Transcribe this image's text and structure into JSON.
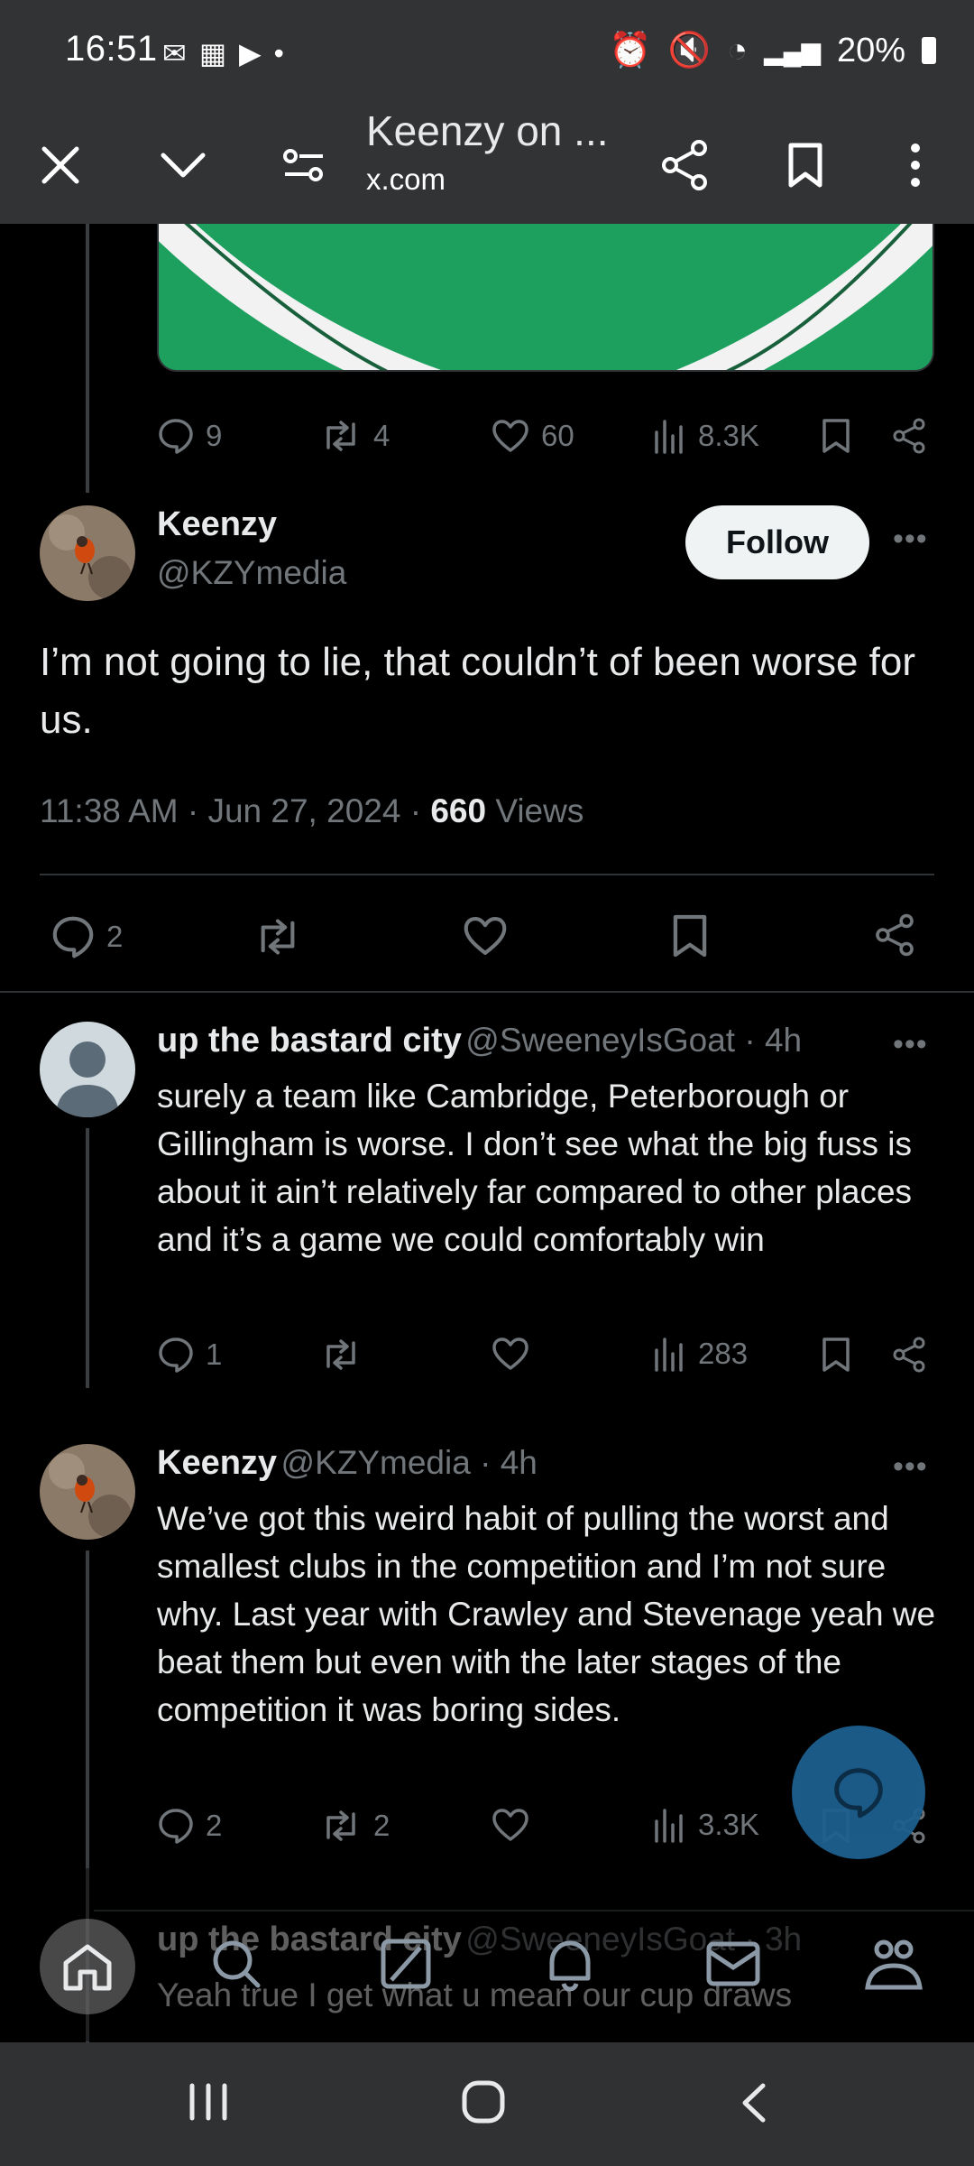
{
  "status": {
    "time": "16:51",
    "battery": "20%"
  },
  "toolbar": {
    "title": "Keenzy on ...",
    "url": "x.com"
  },
  "prev_post_actions": {
    "replies": "9",
    "reposts": "4",
    "likes": "60",
    "views": "8.3K"
  },
  "main_post": {
    "name": "Keenzy",
    "handle": "@KZYmedia",
    "follow_label": "Follow",
    "text": "I’m not going to lie, that couldn’t of been worse for us.",
    "timestamp": "11:38 AM · Jun 27, 2024 · ",
    "views_count": "660",
    "views_label": " Views",
    "replies": "2"
  },
  "replies": [
    {
      "name": "up the bastard city",
      "handle": "@SweeneyIsGoat",
      "time": " · 4h",
      "text": "surely a team like Cambridge, Peterborough or Gillingham is worse. I don’t see what the big fuss is about it ain’t relatively far compared to other places and it’s a game we could comfortably win",
      "replies": "1",
      "reposts": "",
      "likes": "",
      "views": "283"
    },
    {
      "name": "Keenzy",
      "handle": "@KZYmedia",
      "time": " · 4h",
      "text": "We’ve got this weird habit of pulling the worst and smallest clubs in the competition and I’m not sure why. Last year with Crawley and Stevenage yeah we beat them but even with the later stages of the competition it was boring sides.",
      "replies": "2",
      "reposts": "2",
      "likes": "",
      "views": "3.3K"
    },
    {
      "name": "up the bastard city",
      "handle": "@SweeneyIsGoat",
      "time": " · 3h",
      "text": "Yeah true I get what u mean our cup draws"
    }
  ],
  "colors": {
    "bar": "#323335",
    "fab": "#1d9bf0",
    "follow_bg": "#eff3f4",
    "muted": "#71767b"
  }
}
